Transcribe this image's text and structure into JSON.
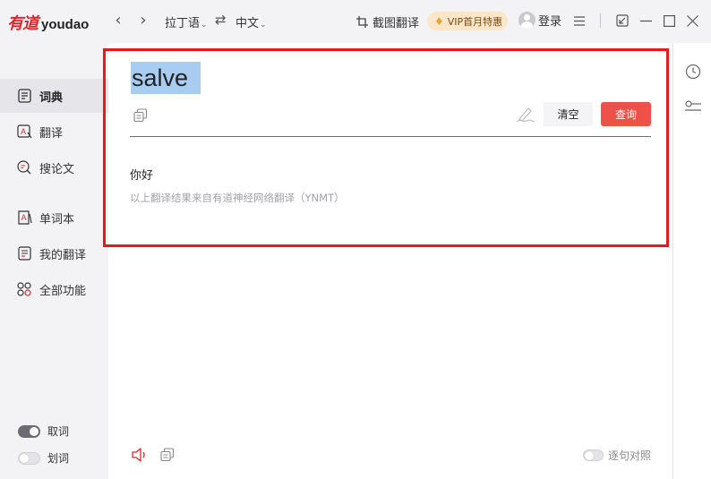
{
  "app": {
    "logo_cn": "有道",
    "logo_en": "youdao"
  },
  "titlebar": {
    "back_icon": "chevron-left-icon",
    "forward_icon": "chevron-right-icon",
    "source_lang": "拉丁语",
    "swap_icon": "swap-icon",
    "target_lang": "中文",
    "screenshot_translate": "截图翻译",
    "vip_label": "VIP首月特惠",
    "login_label": "登录",
    "menu_icon": "hamburger-icon",
    "mini_icon": "mini-mode-icon",
    "minimize_icon": "minimize-icon",
    "maximize_icon": "maximize-icon",
    "close_icon": "close-icon"
  },
  "sidebar": {
    "items": [
      {
        "label": "词典",
        "icon": "dictionary-icon",
        "active": true
      },
      {
        "label": "翻译",
        "icon": "translate-icon",
        "active": false
      },
      {
        "label": "搜论文",
        "icon": "search-paper-icon",
        "active": false
      },
      {
        "label": "单词本",
        "icon": "wordbook-icon",
        "active": false
      },
      {
        "label": "我的翻译",
        "icon": "my-translation-icon",
        "active": false
      },
      {
        "label": "全部功能",
        "icon": "all-features-icon",
        "active": false
      }
    ],
    "toggles": [
      {
        "label": "取词",
        "on": true
      },
      {
        "label": "划词",
        "on": false
      }
    ]
  },
  "main": {
    "query": "salve",
    "clear_label": "清空",
    "query_label": "查询",
    "result": "你好",
    "result_note": "以上翻译结果来自有道神经网络翻译（YNMT）",
    "sentence_compare_label": "逐句对照",
    "sentence_compare_on": false
  },
  "right_rail": {
    "icons": [
      "history-icon",
      "settings-slider-icon"
    ]
  },
  "colors": {
    "brand_red": "#e0262b",
    "query_button": "#ee5148",
    "highlight_border": "#e31b1b",
    "selection": "#a9cdf0"
  }
}
